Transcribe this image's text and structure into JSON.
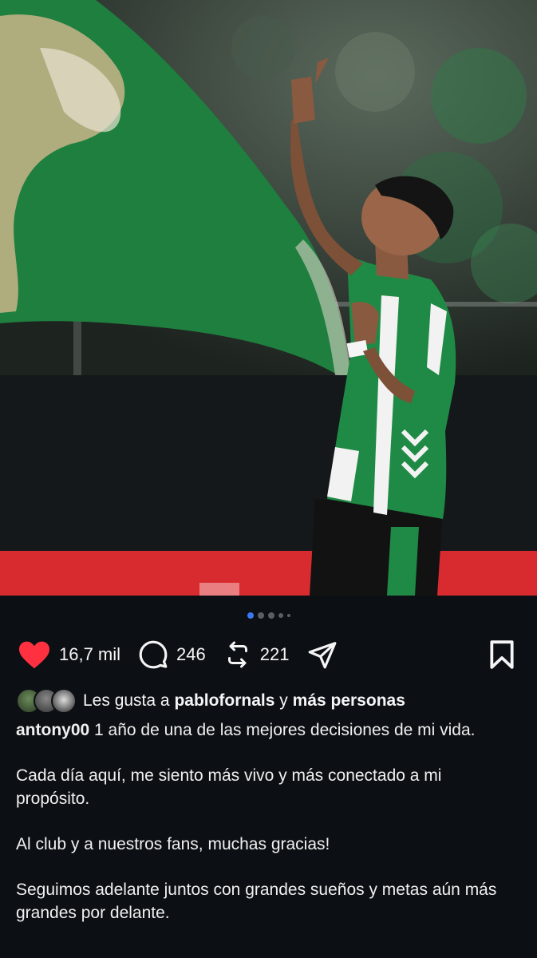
{
  "post": {
    "carousel": {
      "total": 5,
      "active_index": 0
    },
    "actions": {
      "likes": "16,7 mil",
      "comments": "246",
      "reposts": "221"
    },
    "liked_by": {
      "prefix": "Les gusta a",
      "user": "pablofornals",
      "connector": "y",
      "others": "más personas"
    },
    "caption": {
      "username": "antony00",
      "paragraphs": [
        "1 año de una de las mejores decisiones de mi vida.",
        "Cada día aquí, me siento más vivo y más conectado a mi propósito.",
        "Al club y a nuestros fans, muchas gracias!",
        "Seguimos adelante juntos con grandes sueños y metas aún más grandes por delante."
      ]
    }
  },
  "colors": {
    "background": "#0c1014",
    "like_red": "#ff3040",
    "active_dot": "#3a78f2",
    "jersey_green": "#1f8a45"
  },
  "icons": [
    "heart-icon",
    "comment-icon",
    "repost-icon",
    "share-icon",
    "bookmark-icon"
  ]
}
